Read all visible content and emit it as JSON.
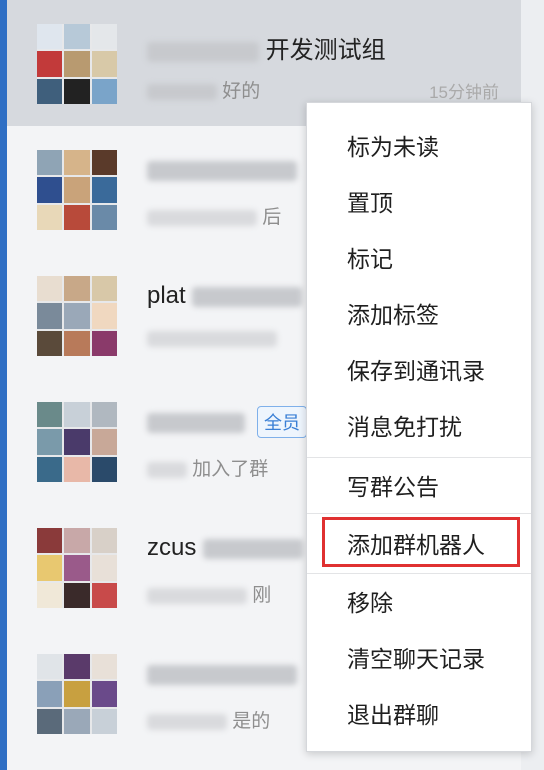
{
  "chat_list": {
    "rows": [
      {
        "name_suffix": "开发测试组",
        "preview_suffix": "好的",
        "time": "15分钟前",
        "selected": true,
        "avatar_colors": [
          "#dfe6ee",
          "#b7c9d8",
          "#e4e7ea",
          "#c23a3a",
          "#b89a70",
          "#d8c9a8",
          "#3f5f7c",
          "#222222",
          "#7aa4c9"
        ]
      },
      {
        "name_suffix": "",
        "preview_suffix": "后",
        "time": "",
        "selected": false,
        "avatar_colors": [
          "#8fa4b5",
          "#d6b48a",
          "#5a3a2a",
          "#2f4f8f",
          "#c9a37a",
          "#3a6a9a",
          "#e8d8b8",
          "#b84a3a",
          "#6a8aa8"
        ]
      },
      {
        "name_prefix": "plat",
        "preview_suffix": "",
        "time": "",
        "selected": false,
        "avatar_colors": [
          "#e8ddd0",
          "#c8a888",
          "#d8c8a8",
          "#7a8a9a",
          "#9aa8b8",
          "#f0d8c0",
          "#5a4a3a",
          "#b87a5a",
          "#8a3a6a"
        ]
      },
      {
        "name_prefix": "",
        "badge": "全员",
        "preview_suffix": "加入了群",
        "time": "",
        "selected": false,
        "avatar_colors": [
          "#6a8a8a",
          "#c8d0d8",
          "#b0b8c0",
          "#7a9aaa",
          "#4a3a6a",
          "#c8a898",
          "#3a6a8a",
          "#e8b8a8",
          "#2a4a6a"
        ]
      },
      {
        "name_prefix": "zcus",
        "preview_suffix": "刚",
        "time": "",
        "selected": false,
        "avatar_colors": [
          "#8a3a3a",
          "#c8a8a8",
          "#d8d0c8",
          "#e8c870",
          "#9a5a8a",
          "#e8e0d8",
          "#f0e8d8",
          "#3a2a2a",
          "#c84a4a"
        ]
      },
      {
        "name_prefix": "",
        "preview_suffix": "是的",
        "time": "",
        "selected": false,
        "avatar_colors": [
          "#e0e4e8",
          "#5a3a6a",
          "#e8e0d8",
          "#8aa0b8",
          "#c8a040",
          "#6a4a8a",
          "#5a6a7a",
          "#9aa8b8",
          "#c8d0d8"
        ]
      }
    ]
  },
  "context_menu": {
    "items": [
      {
        "label": "标为未读",
        "name": "menu-mark-unread"
      },
      {
        "label": "置顶",
        "name": "menu-pin-top"
      },
      {
        "label": "标记",
        "name": "menu-mark"
      },
      {
        "label": "添加标签",
        "name": "menu-add-tag"
      },
      {
        "label": "保存到通讯录",
        "name": "menu-save-contacts"
      },
      {
        "label": "消息免打扰",
        "name": "menu-mute"
      },
      {
        "label": "写群公告",
        "name": "menu-group-announcement"
      },
      {
        "label": "添加群机器人",
        "name": "menu-add-group-robot"
      },
      {
        "label": "移除",
        "name": "menu-remove"
      },
      {
        "label": "清空聊天记录",
        "name": "menu-clear-history"
      },
      {
        "label": "退出群聊",
        "name": "menu-leave-group"
      }
    ],
    "highlighted_item": "添加群机器人",
    "highlight_color": "#e03131"
  }
}
